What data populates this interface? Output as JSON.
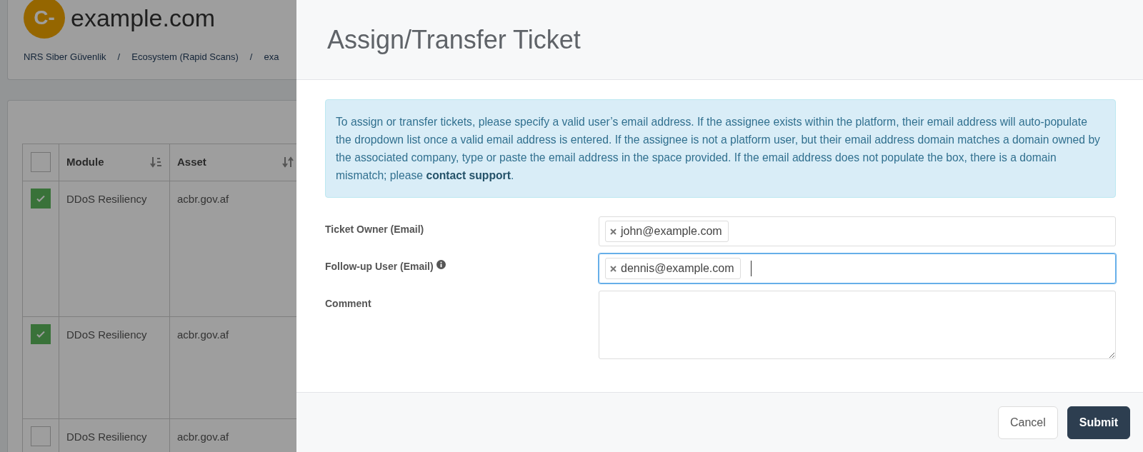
{
  "site": {
    "logo_text": "C-",
    "name": "example.com"
  },
  "breadcrumb": {
    "separator": "/",
    "items": [
      "NRS Siber Güvenlik",
      "Ecosystem (Rapid Scans)",
      "exa"
    ]
  },
  "table": {
    "select_all": {
      "checked": false
    },
    "columns": [
      "Module",
      "Asset"
    ],
    "rows": [
      {
        "checked": true,
        "cells": [
          "DDoS Resiliency",
          "acbr.gov.af"
        ]
      },
      {
        "checked": true,
        "cells": [
          "DDoS Resiliency",
          "acbr.gov.af"
        ]
      },
      {
        "checked": false,
        "cells": [
          "DDoS Resiliency",
          "acbr.gov.af"
        ]
      }
    ]
  },
  "modal": {
    "title": "Assign/Transfer Ticket",
    "alert": {
      "text": "To assign or transfer tickets, please specify a valid user’s email address. If the assignee exists within the platform, their email address will auto-populate the dropdown list once a valid email address is entered. If the assignee is not a platform user, but their email address domain matches a domain owned by the associated company, type or paste the email address in the space provided. If the email address does not populate the box, there is a domain mismatch; please ",
      "link": "contact support",
      "after": "."
    },
    "fields": [
      {
        "kind": "tags",
        "label": "Ticket Owner (Email)",
        "focused": false,
        "tags": [
          "john@example.com"
        ]
      },
      {
        "kind": "tags",
        "label": "Follow-up User (Email)",
        "info": true,
        "focused": true,
        "tags": [
          "dennis@example.com"
        ]
      },
      {
        "kind": "textarea",
        "label": "Comment"
      }
    ],
    "buttons": [
      {
        "label": "Cancel",
        "kind": "secondary"
      },
      {
        "label": "Submit",
        "kind": "primary"
      }
    ]
  }
}
